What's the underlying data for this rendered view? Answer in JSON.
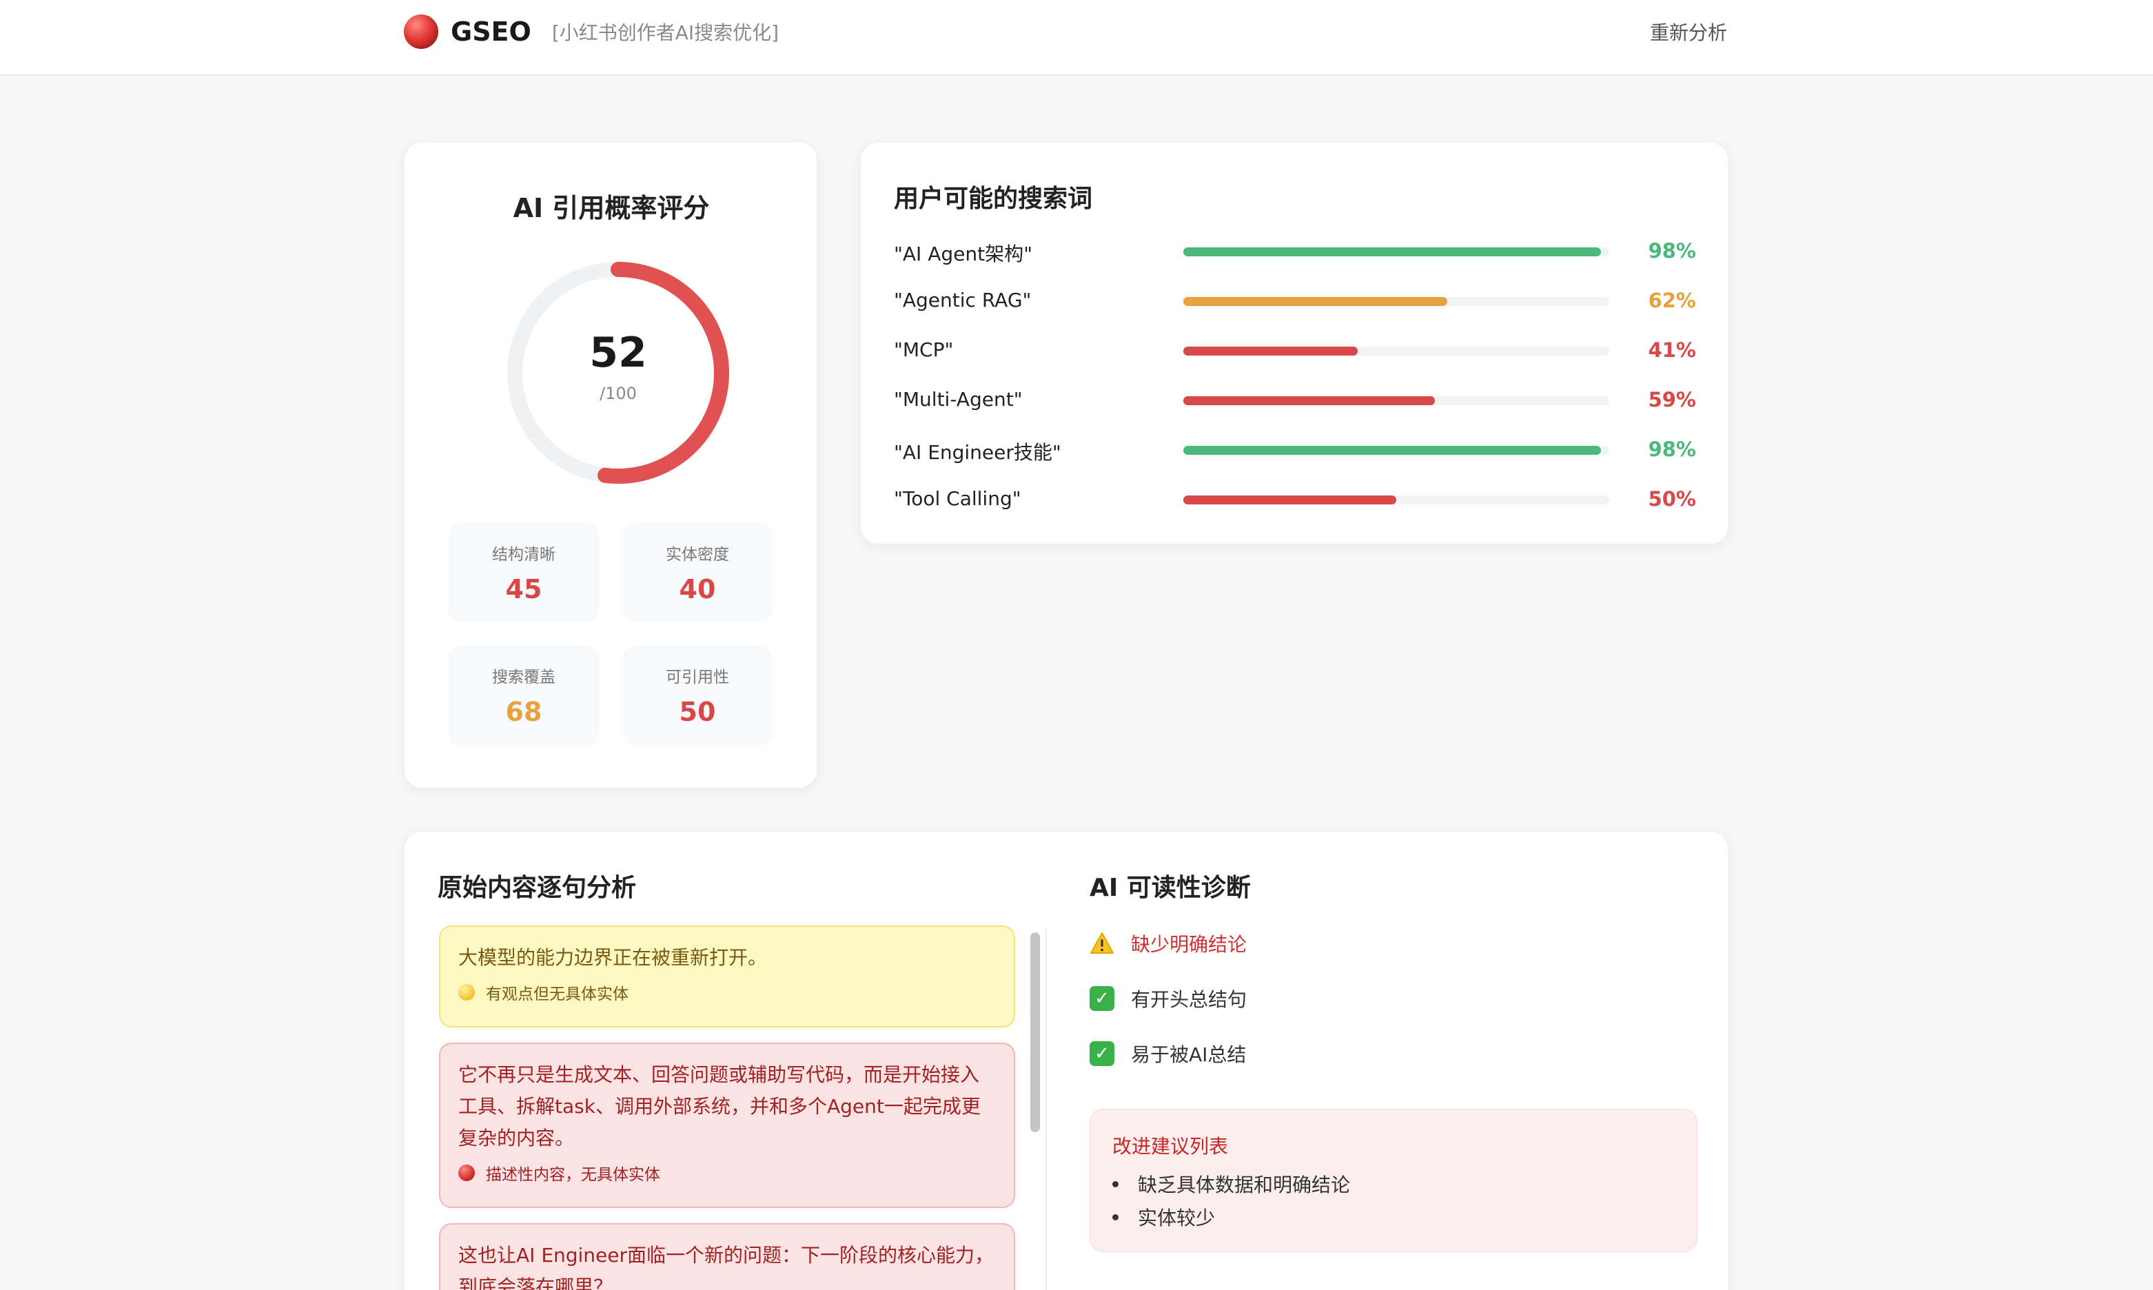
{
  "header": {
    "brand_name": "GSEO",
    "brand_subtitle": "[小红书创作者AI搜索优化]",
    "reanalyze_label": "重新分析"
  },
  "score_card": {
    "title": "AI 引用概率评分",
    "score": "52",
    "score_max": "/100",
    "score_fraction": 0.52,
    "ring_color": "#e05252",
    "metrics": [
      {
        "label": "结构清晰",
        "value": "45",
        "color": "#d94848"
      },
      {
        "label": "实体密度",
        "value": "40",
        "color": "#d94848"
      },
      {
        "label": "搜索覆盖",
        "value": "68",
        "color": "#e6a23c"
      },
      {
        "label": "可引用性",
        "value": "50",
        "color": "#d94848"
      }
    ]
  },
  "queries": {
    "title": "用户可能的搜索词",
    "items": [
      {
        "label": "\"AI Agent架构\"",
        "pct": "98%",
        "value": 0.98,
        "color": "#4cb87a"
      },
      {
        "label": "\"Agentic RAG\"",
        "pct": "62%",
        "value": 0.62,
        "color": "#e6a23c"
      },
      {
        "label": "\"MCP\"",
        "pct": "41%",
        "value": 0.41,
        "color": "#d94848"
      },
      {
        "label": "\"Multi-Agent\"",
        "pct": "59%",
        "value": 0.59,
        "color": "#d94848"
      },
      {
        "label": "\"AI Engineer技能\"",
        "pct": "98%",
        "value": 0.98,
        "color": "#4cb87a"
      },
      {
        "label": "\"Tool Calling\"",
        "pct": "50%",
        "value": 0.5,
        "color": "#d94848"
      }
    ]
  },
  "analysis": {
    "left_title": "原始内容逐句分析",
    "sentences": [
      {
        "text": "大模型的能力边界正在被重新打开。",
        "tag": "有观点但无具体实体",
        "level": "yellow"
      },
      {
        "text": "它不再只是生成文本、回答问题或辅助写代码，而是开始接入工具、拆解task、调用外部系统，并和多个Agent一起完成更复杂的内容。",
        "tag": "描述性内容，无具体实体",
        "level": "red"
      },
      {
        "text": "这也让AI Engineer面临一个新的问题：下一阶段的核心能力，到底会落在哪里？",
        "tag": "",
        "level": "red"
      }
    ],
    "right_title": "AI 可读性诊断",
    "diagnostics": [
      {
        "icon": "warning-icon",
        "text": "缺少明确结论",
        "color": "#d32f2f"
      },
      {
        "icon": "check-icon",
        "text": "有开头总结句",
        "color": "#333333"
      },
      {
        "icon": "check-icon",
        "text": "易于被AI总结",
        "color": "#333333"
      }
    ],
    "improvements": {
      "title": "改进建议列表",
      "items": [
        "缺乏具体数据和明确结论",
        "实体较少"
      ]
    }
  }
}
